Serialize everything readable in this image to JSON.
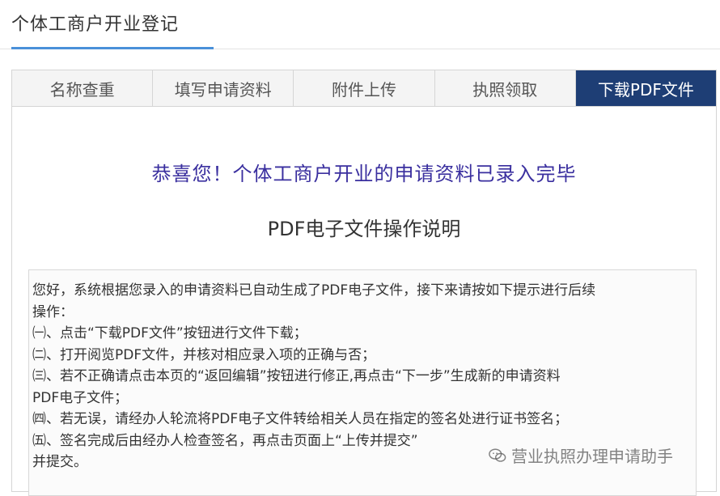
{
  "header": {
    "title": "个体工商户开业登记"
  },
  "tabs": [
    {
      "label": "名称查重"
    },
    {
      "label": "填写申请资料"
    },
    {
      "label": "附件上传"
    },
    {
      "label": "执照领取"
    },
    {
      "label": "下载PDF文件"
    }
  ],
  "content": {
    "congrats": "恭喜您！个体工商户开业的申请资料已录入完毕",
    "instructions_title": "PDF电子文件操作说明",
    "lines": [
      "您好，系统根据您录入的申请资料已自动生成了PDF电子文件，接下来请按如下提示进行后续",
      "操作：",
      "㈠、点击“下载PDF文件”按钮进行文件下载；",
      "㈡、打开阅览PDF文件，并核对相应录入项的正确与否；",
      "㈢、若不正确请点击本页的“返回编辑”按钮进行修正,再点击“下一步”生成新的申请资料",
      "PDF电子文件；",
      "㈣、若无误，请经办人轮流将PDF电子文件转给相关人员在指定的签名处进行证书签名；",
      "㈤、签名完成后由经办人检查签名，再点击页面上“上传并提交”",
      "并提交。"
    ]
  },
  "watermark": {
    "text": "营业执照办理申请助手",
    "icon": "wechat-icon"
  },
  "colors": {
    "accent": "#4a90d9",
    "active_tab": "#1e3e75",
    "congrats_text": "#3a2f9f"
  }
}
